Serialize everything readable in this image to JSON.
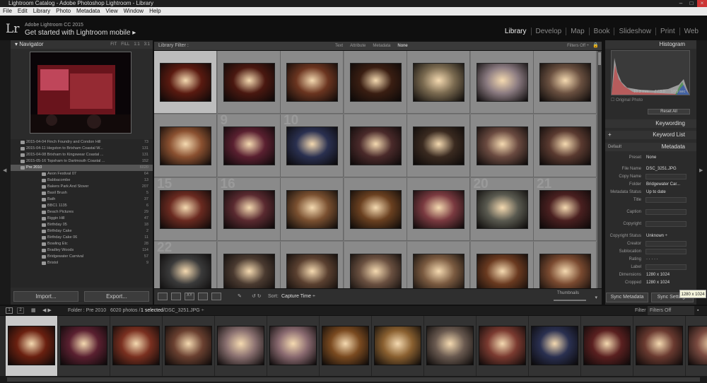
{
  "window": {
    "title": "Lightroom Catalog - Adobe Photoshop Lightroom - Library"
  },
  "menu": [
    "File",
    "Edit",
    "Library",
    "Photo",
    "Metadata",
    "View",
    "Window",
    "Help"
  ],
  "identity": {
    "logo": "Lr",
    "product": "Adobe Lightroom CC 2015",
    "mobile": "Get started with Lightroom mobile ▸"
  },
  "modules": [
    "Library",
    "Develop",
    "Map",
    "Book",
    "Slideshow",
    "Print",
    "Web"
  ],
  "navigator": {
    "title": "Navigator",
    "options": [
      "FIT",
      "FILL",
      "1:1",
      "3:1"
    ]
  },
  "folders": [
    {
      "name": "2015-04-04 Finch Foundry and Condon Hill",
      "count": "73"
    },
    {
      "name": "2015-04-11 Hegston to Brixham Coastal W...",
      "count": "131"
    },
    {
      "name": "2015-04-08 Brixham to Kingswear Coastal ...",
      "count": "131"
    },
    {
      "name": "2015-05-16 Topsham to Dartmouth Coastal ...",
      "count": "152"
    },
    {
      "name": "Pre 2010",
      "count": "6020",
      "selected": true
    },
    {
      "name": "Aeon Festival 07",
      "count": "64"
    },
    {
      "name": "Babbacombe",
      "count": "13"
    },
    {
      "name": "Bakers Park And Stover",
      "count": "207"
    },
    {
      "name": "Basil Brush",
      "count": "5"
    },
    {
      "name": "Bath",
      "count": "37"
    },
    {
      "name": "BBC1 1135",
      "count": "6"
    },
    {
      "name": "Beach Pictures",
      "count": "29"
    },
    {
      "name": "Biggin Hill",
      "count": "47"
    },
    {
      "name": "Birthday 05",
      "count": "18"
    },
    {
      "name": "Birthday Cake",
      "count": "2"
    },
    {
      "name": "Birthday Cake 06",
      "count": "11"
    },
    {
      "name": "Bowling Etc",
      "count": "28"
    },
    {
      "name": "Bradley Woods",
      "count": "114"
    },
    {
      "name": "Bridgewater Carnival",
      "count": "57"
    },
    {
      "name": "Bristol",
      "count": "9"
    }
  ],
  "left_buttons": {
    "import": "Import...",
    "export": "Export..."
  },
  "filter": {
    "label": "Library Filter :",
    "tabs": [
      "Text",
      "Attribute",
      "Metadata",
      "None"
    ],
    "active": "None",
    "filters_off": "Filters Off ÷"
  },
  "grid": {
    "rows": [
      [
        "",
        "",
        "",
        "",
        "",
        "",
        ""
      ],
      [
        "",
        "9",
        "10",
        "",
        "",
        "",
        ""
      ],
      [
        "15",
        "16",
        "",
        "",
        "",
        "20",
        "21"
      ],
      [
        "22",
        "",
        "",
        "",
        "",
        "",
        ""
      ]
    ],
    "colors": [
      [
        "#5a1a10",
        "#4a1810",
        "#6b3520",
        "#3a1e12",
        "#7a6a50",
        "#8a7a80",
        "#6a5040"
      ],
      [
        "#8a5030",
        "#5a2030",
        "#2a3050",
        "#4a2a2a",
        "#3a2a20",
        "#6a4a40",
        "#5a3a30"
      ],
      [
        "#6a2a20",
        "#5a2a30",
        "#7a5030",
        "#6a4020",
        "#7a3a40",
        "#5a5a50",
        "#4a2020"
      ],
      [
        "#3a3a3a",
        "#4a3a30",
        "#5a4030",
        "#6a5040",
        "#7a5a40",
        "#6a3a20",
        "#7a4a30"
      ]
    ]
  },
  "toolbar": {
    "sort_label": "Sort:",
    "sort_value": "Capture Time ÷",
    "thumbnails": "Thumbnails"
  },
  "right": {
    "histogram": "Histogram",
    "exif": [
      "10.3 mm",
      "ƒ / 3.0",
      "1/65 sec"
    ],
    "original_photo": "Original Photo",
    "reset_all": "Reset All",
    "keywording": "Keywording",
    "keyword_list": "Keyword List",
    "metadata": "Metadata",
    "default": "Default",
    "preset_label": "Preset",
    "preset_value": "None",
    "fields": [
      {
        "label": "File Name",
        "value": "DSC_3251.JPG"
      },
      {
        "label": "Copy Name",
        "value": ""
      },
      {
        "label": "Folder",
        "value": "Bridgewater Car..."
      },
      {
        "label": "Metadata Status",
        "value": "Up to date"
      },
      {
        "label": "Title",
        "value": ""
      },
      {
        "label": "Caption",
        "value": ""
      },
      {
        "label": "Copyright",
        "value": ""
      },
      {
        "label": "Copyright Status",
        "value": "Unknown ÷"
      },
      {
        "label": "Creator",
        "value": ""
      },
      {
        "label": "Sublocation",
        "value": ""
      },
      {
        "label": "Rating",
        "value": "· · · · ·"
      },
      {
        "label": "Label",
        "value": ""
      },
      {
        "label": "Dimensions",
        "value": "1280 x 1024"
      },
      {
        "label": "Cropped",
        "value": "1280 x 1024"
      }
    ],
    "sync_metadata": "Sync Metadata",
    "sync_settings": "Sync Settings",
    "tooltip": "1280 x 1024"
  },
  "filmstrip": {
    "folder": "Folder : Pre 2010",
    "count": "6020 photos /",
    "selected": "1 selected",
    "path": "/DSC_3251.JPG ÷",
    "filter_label": "Filter :",
    "filter_value": "Filters Off",
    "colors": [
      "#6a2010",
      "#5a2030",
      "#7a3020",
      "#6a4030",
      "#8a7070",
      "#8a6a70",
      "#7a4a20",
      "#8a6030",
      "#6a5a50",
      "#7a3a30",
      "#2a3050",
      "#5a2020",
      "#6a3a30",
      "#7a4a40"
    ]
  }
}
